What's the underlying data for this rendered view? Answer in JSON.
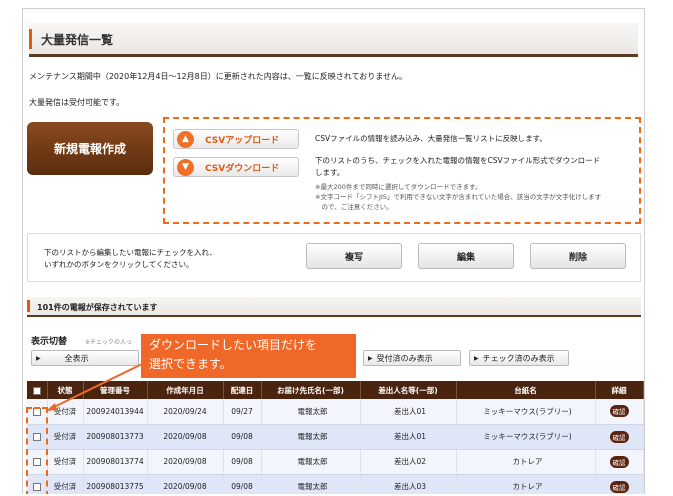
{
  "title": "大量発信一覧",
  "notice1": "メンテナンス期間中（2020年12月4日～12月8日）に更新された内容は、一覧に反映されておりません。",
  "notice2": "大量発信は受付可能です。",
  "new_button": "新規電報作成",
  "csv": {
    "upload": "CSVアップロード",
    "download": "CSVダウンロード",
    "upload_desc": "CSVファイルの情報を読み込み、大量発信一覧リストに反映します。",
    "download_desc_1": "下のリストのうち、チェックを入れた電報の情報をCSVファイル形式でダウンロード",
    "download_desc_2": "します。",
    "note1": "※最大200件まで同時に選択してダウンロードできます。",
    "note2": "※文字コード「シフトJIS」で利用できない文字が含まれていた場合、該当の文字が文字化けします",
    "note3": "　ので、ご注意ください。"
  },
  "actions": {
    "help1": "下のリストから編集したい電報にチェックを入れ、",
    "help2": "いずれかのボタンをクリックしてください。",
    "copy": "複写",
    "edit": "編集",
    "delete": "削除"
  },
  "count_text": "101件の電報が保存されています",
  "filter": {
    "label": "表示切替",
    "note": "※チェックの入っ",
    "all": "全表示",
    "accepted_only": "受付済のみ表示",
    "checked_only": "チェック済のみ表示"
  },
  "callout": {
    "line1": "ダウンロードしたい項目だけを",
    "line2": "選択できます。"
  },
  "columns": [
    "状態",
    "管理番号",
    "作成年月日",
    "配達日",
    "お届け先氏名(一部)",
    "差出人名等(一部)",
    "台紙名",
    "詳細"
  ],
  "rows": [
    {
      "status": "受付済",
      "id": "200924013944",
      "created": "2020/09/24",
      "delivery": "09/27",
      "recipient": "電報太郎",
      "sender": "差出人01",
      "mount": "ミッキーマウス(ラブリー)",
      "detail": "確認"
    },
    {
      "status": "受付済",
      "id": "200908013773",
      "created": "2020/09/08",
      "delivery": "09/08",
      "recipient": "電報太郎",
      "sender": "差出人01",
      "mount": "ミッキーマウス(ラブリー)",
      "detail": "確認"
    },
    {
      "status": "受付済",
      "id": "200908013774",
      "created": "2020/09/08",
      "delivery": "09/08",
      "recipient": "電報太郎",
      "sender": "差出人02",
      "mount": "カトレア",
      "detail": "確認"
    },
    {
      "status": "受付済",
      "id": "200908013775",
      "created": "2020/09/08",
      "delivery": "09/08",
      "recipient": "電報太郎",
      "sender": "差出人03",
      "mount": "カトレア",
      "detail": "確認"
    }
  ],
  "colors": {
    "brand_brown": "#4b2410",
    "accent_orange": "#f06818",
    "row_blue": "#dfe6f7"
  }
}
